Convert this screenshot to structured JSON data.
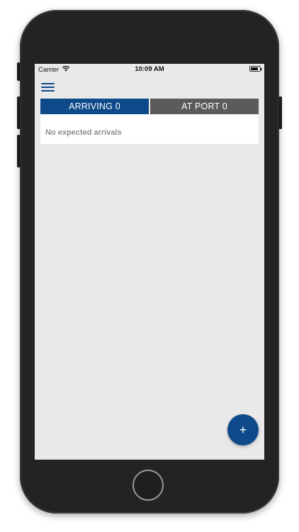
{
  "status_bar": {
    "carrier": "Carrier",
    "time": "10:09 AM",
    "battery_level": 0.8
  },
  "header": {
    "menu_icon": "hamburger-menu-icon"
  },
  "tabs": [
    {
      "label": "ARRIVING 0",
      "selected": true,
      "color": "#0e4a8a"
    },
    {
      "label": "AT PORT 0",
      "selected": false,
      "color": "#5b5b5b"
    }
  ],
  "content": {
    "empty_message": "No expected arrivals"
  },
  "fab": {
    "icon": "plus-icon",
    "glyph": "+",
    "color": "#0e4a8a"
  },
  "colors": {
    "accent": "#0e4a8a",
    "inactive_tab": "#5b5b5b",
    "screen_background": "#e9e9e9"
  }
}
